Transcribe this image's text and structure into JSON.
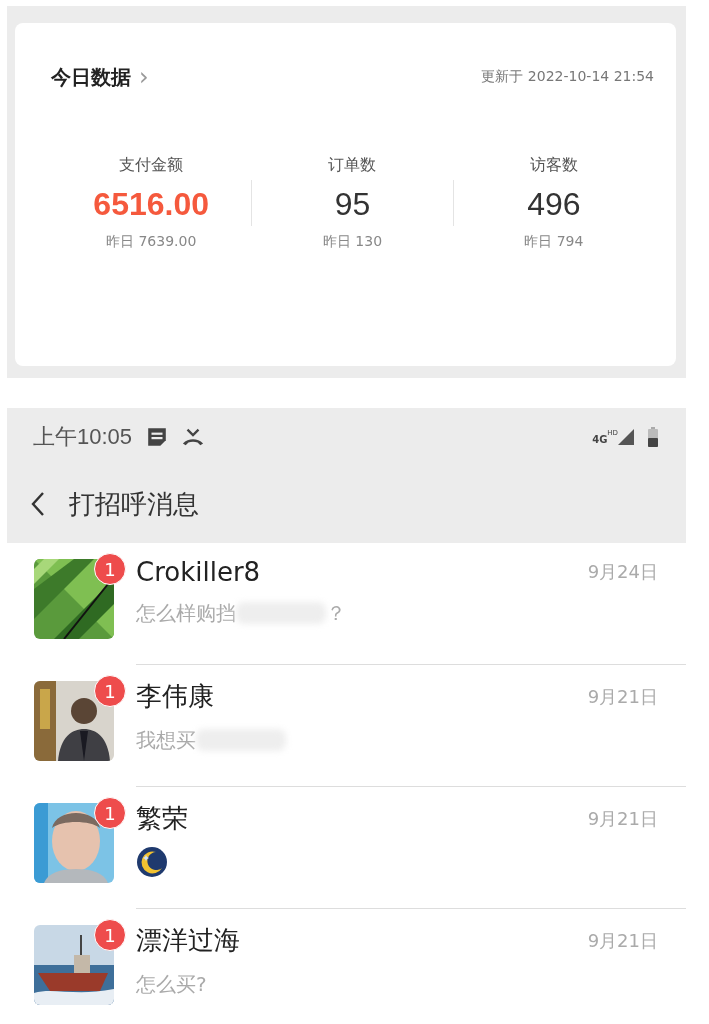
{
  "stats_card": {
    "title": "今日数据",
    "chevron": "›",
    "updated": "更新于 2022-10-14 21:54",
    "metrics": [
      {
        "label": "支付金额",
        "value": "6516.00",
        "emphasis": true,
        "yesterday": "昨日 7639.00"
      },
      {
        "label": "订单数",
        "value": "95",
        "emphasis": false,
        "yesterday": "昨日 130"
      },
      {
        "label": "访客数",
        "value": "496",
        "emphasis": false,
        "yesterday": "昨日 794"
      }
    ]
  },
  "status_bar": {
    "time": "上午10:05",
    "network": "4G",
    "network_badge": "HD"
  },
  "header": {
    "title": "打招呼消息"
  },
  "messages": [
    {
      "name": "Crokiller8",
      "date": "9月24日",
      "badge": "1",
      "kind": "text",
      "preview": "怎么样购挡",
      "redacted": true,
      "preview_end": "？"
    },
    {
      "name": "李伟康",
      "date": "9月21日",
      "badge": "1",
      "kind": "text",
      "preview": "我想买",
      "redacted": true
    },
    {
      "name": "繁荣",
      "date": "9月21日",
      "badge": "1",
      "kind": "emoji"
    },
    {
      "name": "漂洋过海",
      "date": "9月21日",
      "badge": "1",
      "kind": "text",
      "preview": "怎么买?",
      "redacted": false
    }
  ]
}
